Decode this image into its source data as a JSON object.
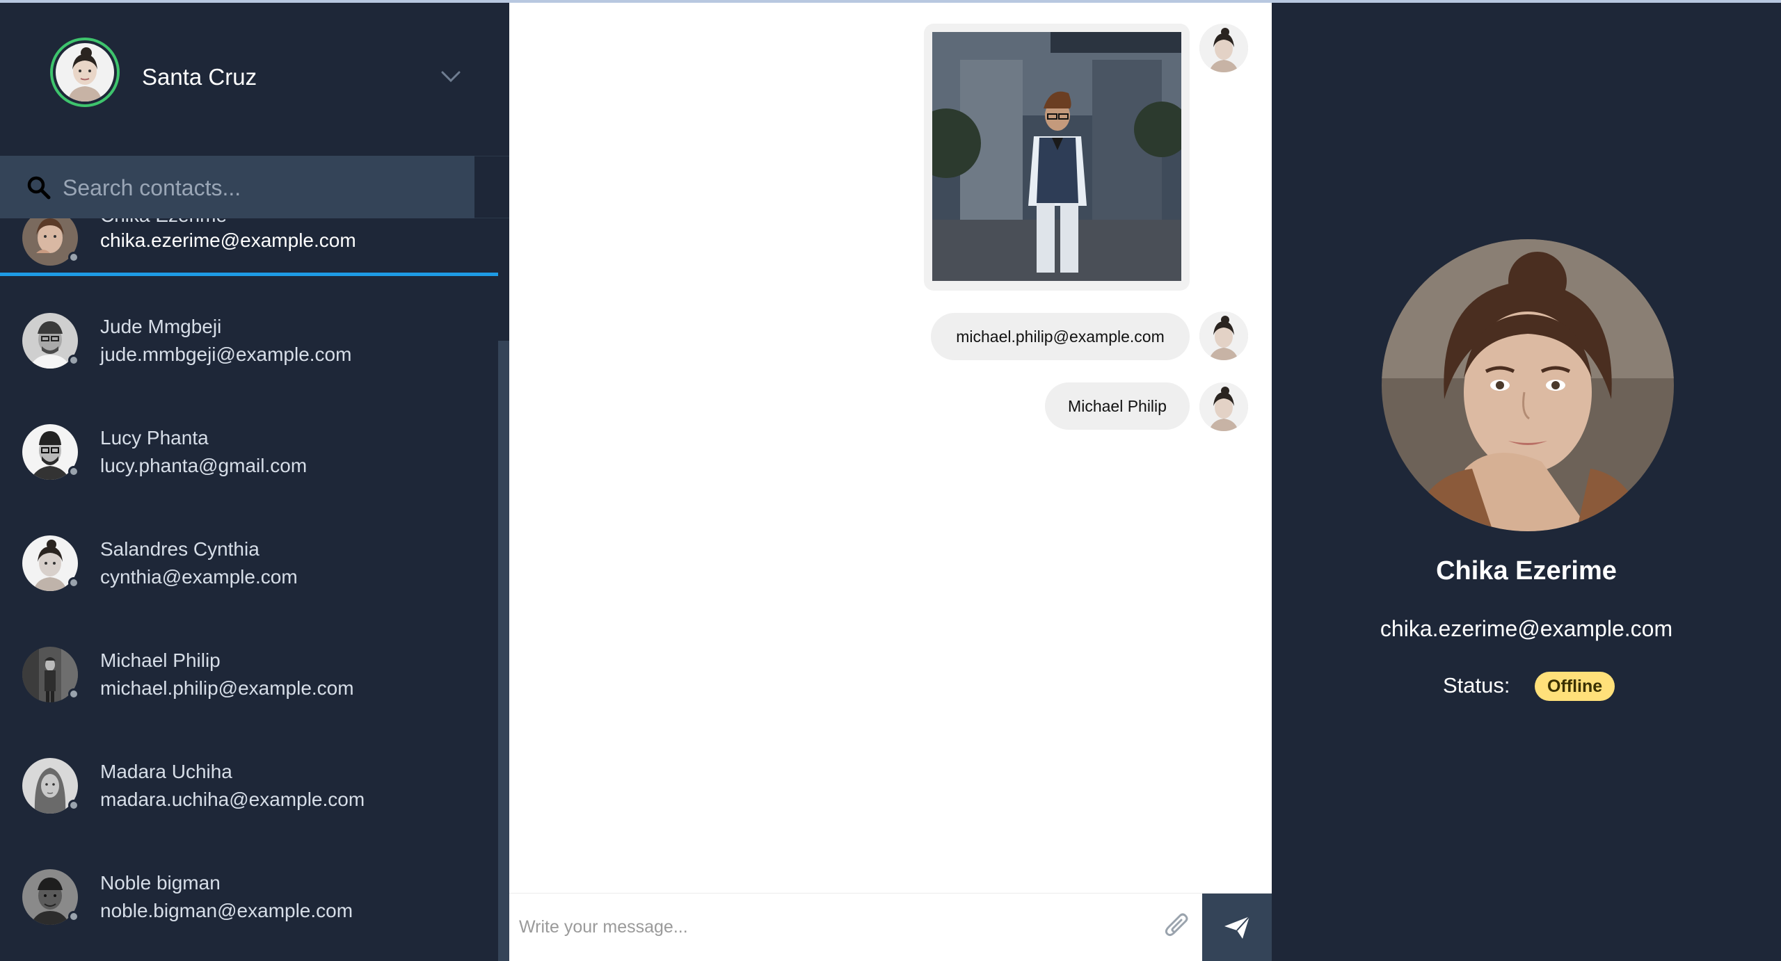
{
  "user": {
    "name": "Santa Cruz"
  },
  "search": {
    "placeholder": "Search contacts..."
  },
  "contacts": [
    {
      "name": "Chika Ezerime",
      "email": "chika.ezerime@example.com",
      "status": "offline",
      "active": true
    },
    {
      "name": "Jude Mmgbeji",
      "email": "jude.mmbgeji@example.com",
      "status": "offline"
    },
    {
      "name": "Lucy Phanta",
      "email": "lucy.phanta@gmail.com",
      "status": "offline"
    },
    {
      "name": "Salandres Cynthia",
      "email": "cynthia@example.com",
      "status": "offline"
    },
    {
      "name": "Michael Philip",
      "email": "michael.philip@example.com",
      "status": "offline"
    },
    {
      "name": "Madara Uchiha",
      "email": "madara.uchiha@example.com",
      "status": "offline"
    },
    {
      "name": "Noble bigman",
      "email": "noble.bigman@example.com",
      "status": "offline"
    }
  ],
  "chat": {
    "messages": [
      {
        "type": "image",
        "content": "street-photo-man-in-vest"
      },
      {
        "type": "text",
        "content": "michael.philip@example.com"
      },
      {
        "type": "text",
        "content": "Michael Philip"
      }
    ],
    "composer": {
      "placeholder": "Write your message..."
    }
  },
  "details": {
    "name": "Chika Ezerime",
    "email": "chika.ezerime@example.com",
    "status_label": "Status:",
    "status_value": "Offline"
  },
  "colors": {
    "panel_bg": "#1e2738",
    "search_bg": "#344458",
    "accent_active": "#1e9be5",
    "online_ring": "#3ec46d",
    "offline_badge": "#ffe07a",
    "chat_bg": "#ffffff",
    "bubble_bg": "#efefef"
  },
  "icons": [
    "chevron-down-icon",
    "search-icon",
    "paperclip-icon",
    "send-icon"
  ]
}
